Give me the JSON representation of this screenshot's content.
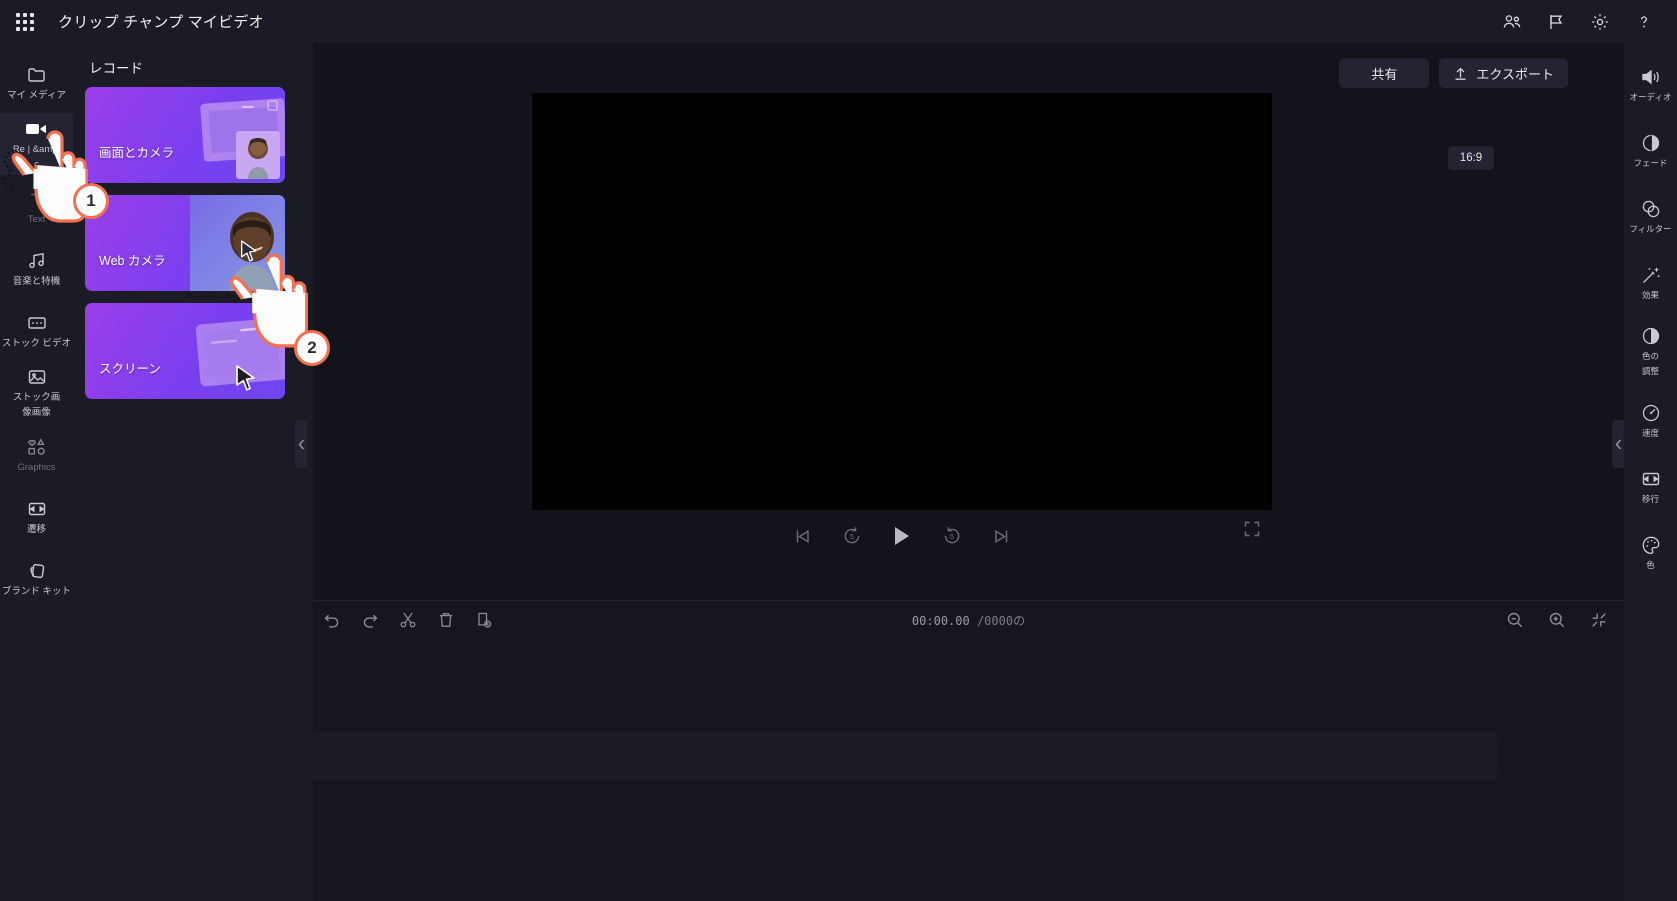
{
  "app": {
    "title": "クリップ チャンプ マイビデオ",
    "waffle_icon": "app-launcher-icon"
  },
  "topbar": {
    "icons": [
      {
        "name": "collaborate-icon",
        "label": "共同作業"
      },
      {
        "name": "flag-feedback-icon",
        "label": "フィードバック"
      },
      {
        "name": "settings-gear-icon",
        "label": "設定"
      },
      {
        "name": "help-question-icon",
        "label": "ヘルプ"
      }
    ]
  },
  "left_rail": {
    "items": [
      {
        "label": "マイ メディア",
        "icon": "folder-icon",
        "active": false,
        "dim": false
      },
      {
        "label": "Re | &amp;",
        "label2": "c",
        "icon": "video-camera-icon",
        "active": true,
        "dim": false
      },
      {
        "label": "Text",
        "icon": "text-icon",
        "active": false,
        "dim": true
      },
      {
        "label": "音楽と特機",
        "icon": "music-note-icon",
        "active": false,
        "dim": false
      },
      {
        "label": "ストック ビデオ",
        "icon": "film-strip-icon",
        "active": false,
        "dim": false
      },
      {
        "label": "ストック画",
        "label2": "像画像",
        "icon": "image-icon",
        "active": false,
        "dim": false
      },
      {
        "label": "Graphics",
        "icon": "shapes-icon",
        "active": false,
        "dim": true
      },
      {
        "label": "遷移",
        "icon": "transition-icon",
        "active": false,
        "dim": false
      },
      {
        "label": "ブランド キット",
        "icon": "brand-kit-icon",
        "active": false,
        "dim": false
      }
    ]
  },
  "panel": {
    "title": "レコード",
    "collapse_icon": "chevron-left-icon",
    "cards": [
      {
        "label": "画面とカメラ",
        "art": "screen-and-camera"
      },
      {
        "label": "Web カメラ",
        "art": "webcam"
      },
      {
        "label": "スクリーン",
        "art": "screen"
      }
    ]
  },
  "stage": {
    "share_label": "共有",
    "export_label": "エクスポート",
    "export_icon": "upload-arrow-icon",
    "ratio_badge": "16:9",
    "collapse_icon": "chevron-left-icon",
    "playback": [
      {
        "name": "skip-to-start-button",
        "icon": "skip-previous-icon"
      },
      {
        "name": "rewind-5-button",
        "icon": "rewind-5-icon",
        "value": "5"
      },
      {
        "name": "play-button",
        "icon": "play-icon"
      },
      {
        "name": "forward-5-button",
        "icon": "forward-5-icon",
        "value": "5"
      },
      {
        "name": "skip-to-end-button",
        "icon": "skip-next-icon"
      }
    ],
    "fullscreen_icon": "fullscreen-icon"
  },
  "timeline": {
    "tools": [
      {
        "name": "undo-button",
        "icon": "undo-icon"
      },
      {
        "name": "redo-button",
        "icon": "redo-icon"
      },
      {
        "name": "split-button",
        "icon": "scissors-icon"
      },
      {
        "name": "delete-button",
        "icon": "trash-icon"
      },
      {
        "name": "duplicate-button",
        "icon": "duplicate-icon"
      }
    ],
    "current_time": "00:00.00",
    "total_time": "/0000の",
    "zoom_tools": [
      {
        "name": "zoom-out-button",
        "icon": "magnifier-minus-icon"
      },
      {
        "name": "zoom-in-button",
        "icon": "magnifier-plus-icon"
      },
      {
        "name": "fit-timeline-button",
        "icon": "fit-icon"
      }
    ]
  },
  "right_rail": {
    "items": [
      {
        "label": "オーディオ",
        "icon": "speaker-icon"
      },
      {
        "label": "フェード",
        "icon": "fade-icon"
      },
      {
        "label": "フィルター",
        "icon": "filter-circles-icon"
      },
      {
        "label": "効果",
        "icon": "magic-wand-icon"
      },
      {
        "label": "色の",
        "label2": "調整",
        "icon": "contrast-icon"
      },
      {
        "label": "速度",
        "icon": "speedometer-icon"
      },
      {
        "label": "移行",
        "icon": "transition-icon"
      },
      {
        "label": "色",
        "icon": "palette-icon"
      }
    ]
  },
  "annotations": {
    "steps": [
      {
        "number": "1",
        "target": "rec-and-create-rail-item"
      },
      {
        "number": "2",
        "target": "webcam-record-card"
      }
    ]
  },
  "colors": {
    "background": "#13131c",
    "chrome": "#1b1b26",
    "surface": "#232331",
    "card_gradient_start": "#9b3ee8",
    "card_gradient_end": "#6d47f0",
    "annotation_accent": "#f4704f",
    "text_primary": "#e6e6ea",
    "text_muted": "#8b8b99"
  }
}
